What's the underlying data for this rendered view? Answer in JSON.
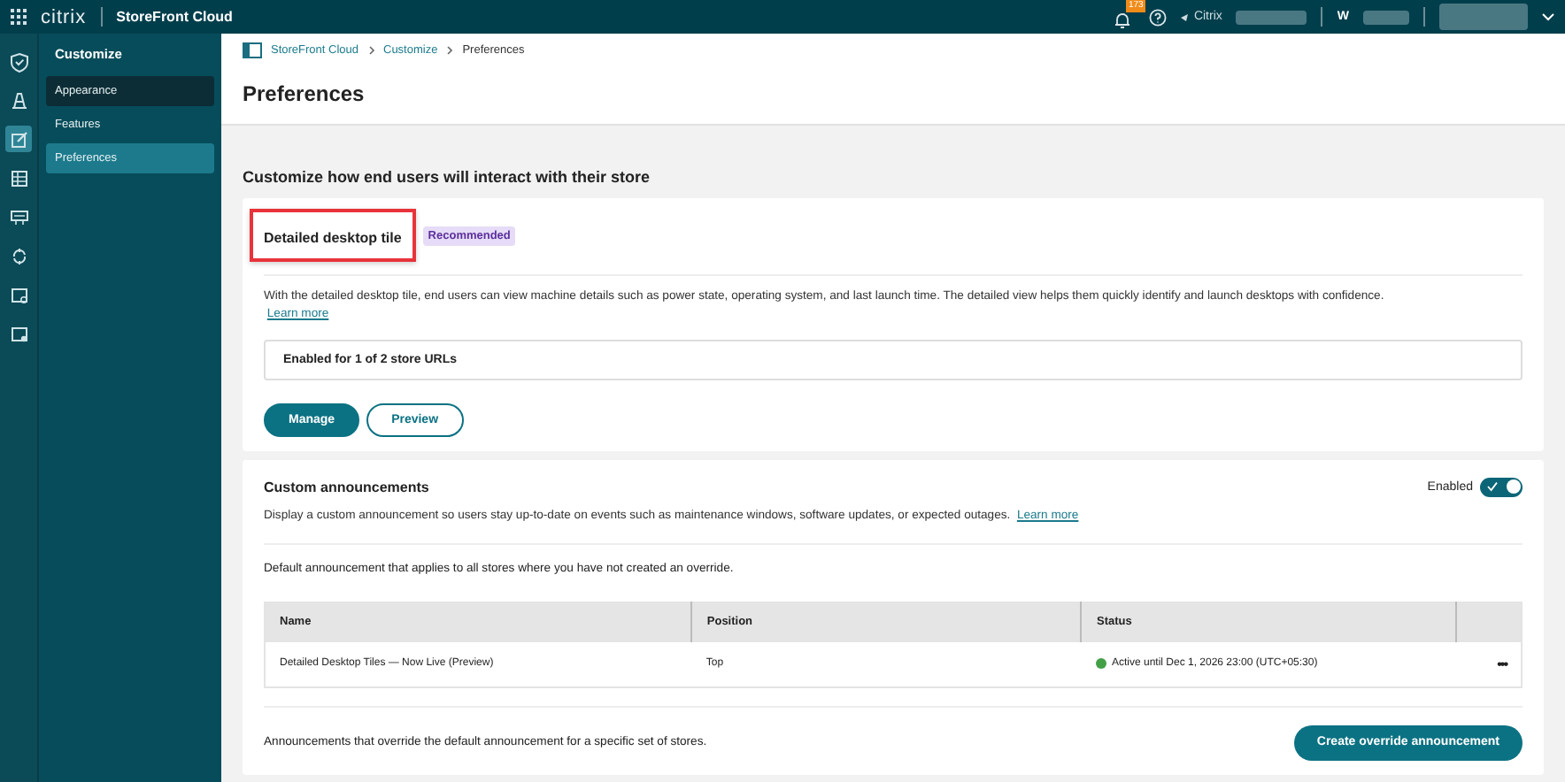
{
  "top_bar": {
    "logo": "citrix",
    "product": "StoreFront Cloud",
    "notification_count": "173",
    "org_label": "Citrix",
    "user_initial": "W"
  },
  "rail": [
    {
      "selected": false
    },
    {
      "selected": false
    },
    {
      "selected": true
    },
    {
      "selected": false
    },
    {
      "selected": false
    },
    {
      "selected": false
    },
    {
      "selected": false
    },
    {
      "selected": false
    }
  ],
  "sidebar": {
    "title": "Customize",
    "items": [
      {
        "label": "Appearance",
        "selected": false,
        "hovered": true
      },
      {
        "label": "Features",
        "selected": false,
        "hovered": false
      },
      {
        "label": "Preferences",
        "selected": true,
        "hovered": false
      }
    ]
  },
  "breadcrumb": [
    "StoreFront Cloud",
    "Customize",
    "Preferences"
  ],
  "page_title": "Preferences",
  "section_heading": "Customize how end users will interact with their store",
  "desktop_tile_card": {
    "title": "Detailed desktop tile",
    "highlighted": true,
    "badge": "Recommended",
    "description": "With the detailed desktop tile, end users can view machine details such as power state, operating system, and last launch time. The detailed view helps them quickly identify and launch desktops with confidence.",
    "link": "Learn more",
    "status": "Enabled for 1 of 2 store URLs",
    "buttons": [
      {
        "label": "Manage",
        "kind": "primary"
      },
      {
        "label": "Preview",
        "kind": "secondary"
      }
    ]
  },
  "announcements_card": {
    "title": "Custom announcements",
    "toggle_label": "Enabled",
    "toggle_on": true,
    "description": "Display a custom announcement so users stay up-to-date on events such as maintenance windows, software updates, or expected outages.",
    "link": "Learn more",
    "default_text": "Default announcement that applies to all stores where you have not created an override.",
    "table": {
      "columns": [
        "Name",
        "Position",
        "Status"
      ],
      "rows": [
        {
          "name": "Detailed Desktop Tiles — Now Live (Preview)",
          "position": "Top",
          "status": "Active until Dec 1, 2026 23:00 (UTC+05:30)",
          "color": "#43a047",
          "menu": "•••"
        }
      ]
    },
    "override_text": "Announcements that override the default announcement for a specific set of stores.",
    "create_button": "Create override announcement"
  }
}
